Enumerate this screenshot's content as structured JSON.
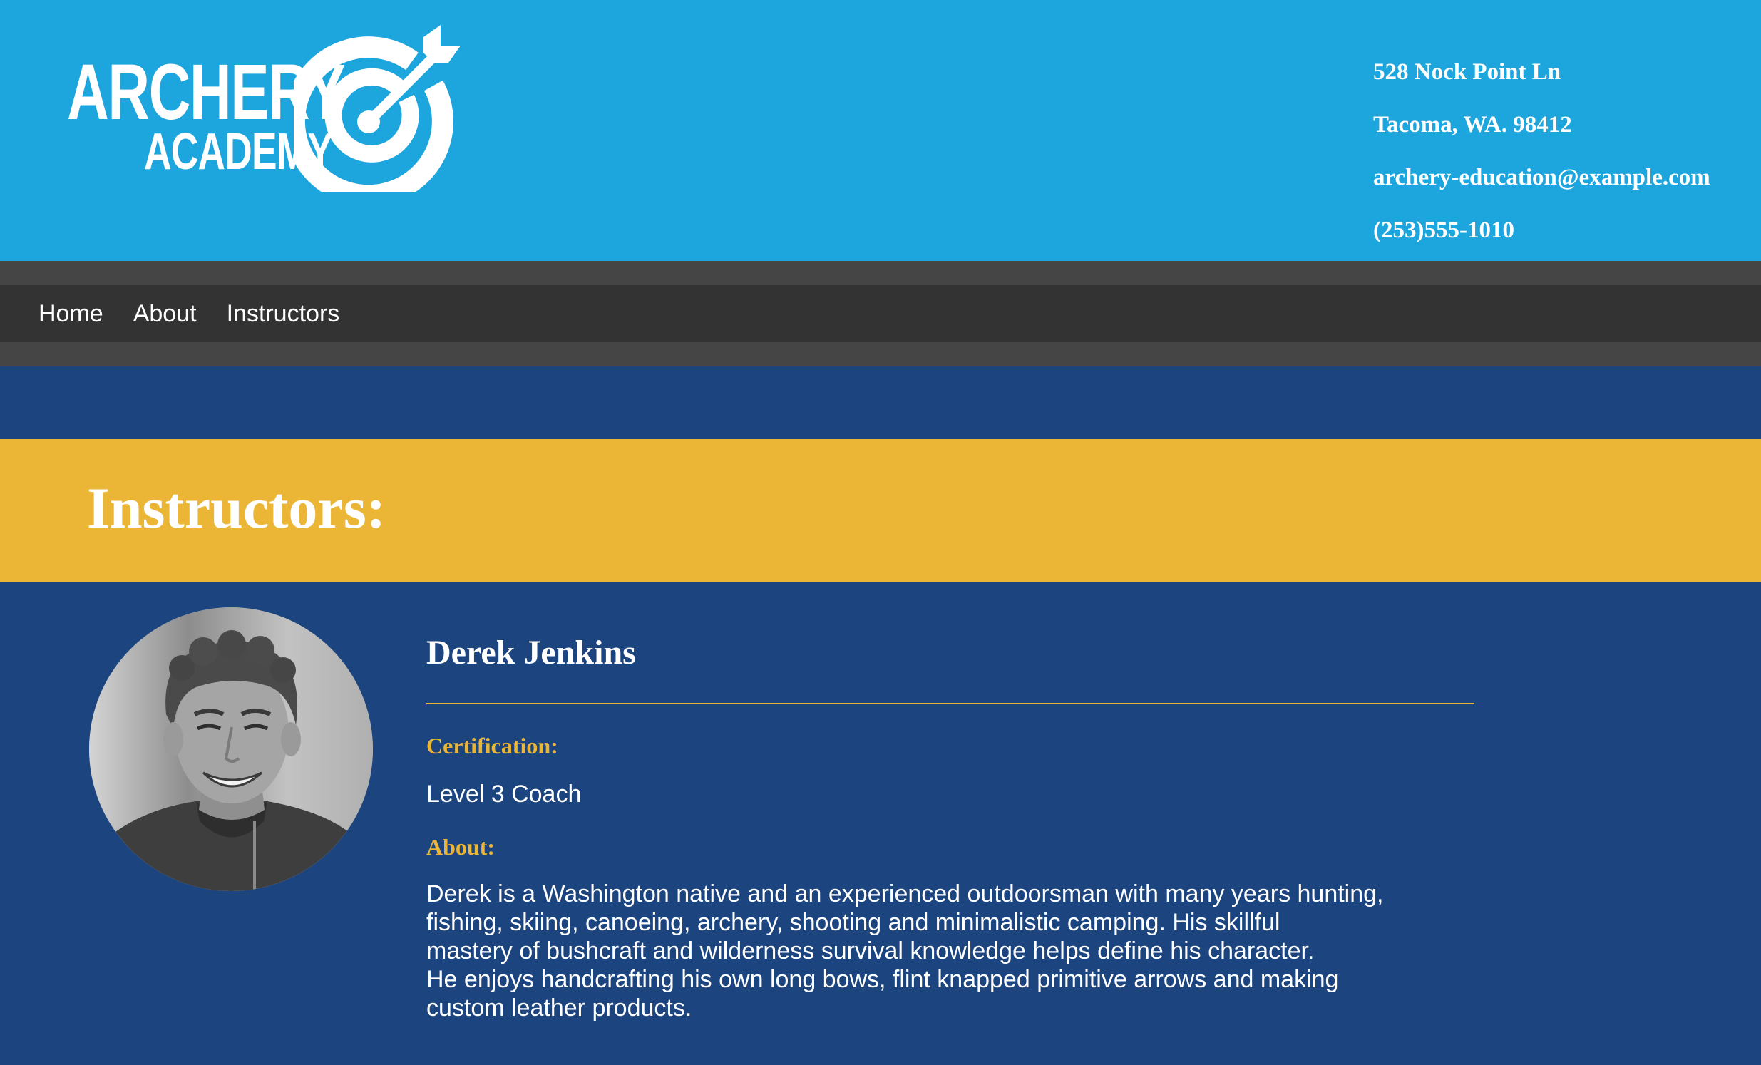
{
  "brand": {
    "line1": "ARCHERY",
    "line2": "ACADEMY",
    "logo_icon": "target-arrow-icon"
  },
  "contact": {
    "street": "528 Nock Point Ln",
    "city": "Tacoma, WA. 98412",
    "email": "archery-education@example.com",
    "phone": "(253)555-1010"
  },
  "nav": {
    "items": [
      {
        "label": "Home"
      },
      {
        "label": "About"
      },
      {
        "label": "Instructors"
      }
    ]
  },
  "banner": {
    "title": "Instructors:"
  },
  "instructor": {
    "name": "Derek Jenkins",
    "certification_label": "Certification:",
    "certification": "Level 3 Coach",
    "about_label": "About:",
    "about_lines": [
      "Derek is a Washington native and an experienced outdoorsman with many years hunting,",
      "fishing, skiing, canoeing, archery, shooting and minimalistic camping. His skillful",
      "mastery of bushcraft and wilderness survival knowledge helps define his character.",
      "He enjoys handcrafting his own long bows, flint knapped primitive arrows and making",
      "custom leather products."
    ]
  },
  "colors": {
    "header_bg": "#1da5dd",
    "nav_outer": "#454545",
    "nav_bar": "#333333",
    "page_bg": "#1c4580",
    "accent": "#ebb635"
  }
}
